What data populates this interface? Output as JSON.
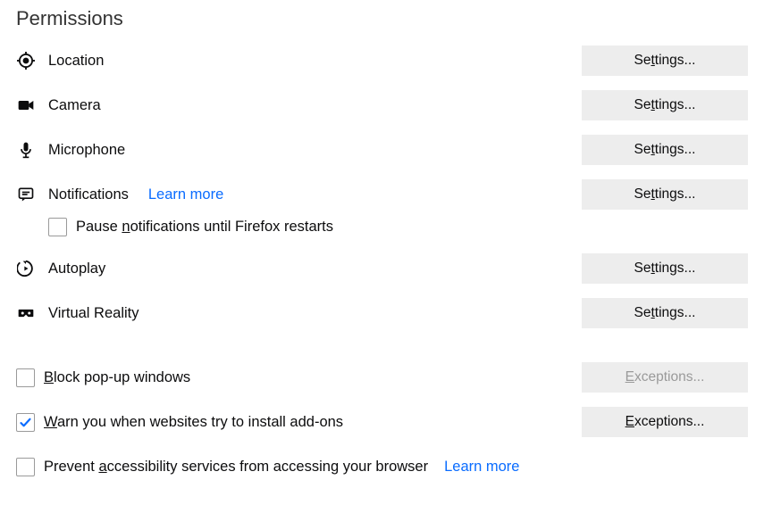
{
  "title": "Permissions",
  "items": {
    "location": {
      "label": "Location",
      "button": "Se<u>t</u>tings..."
    },
    "camera": {
      "label": "Camera",
      "button": "Se<u>t</u>tings..."
    },
    "microphone": {
      "label": "Microphone",
      "button": "Se<u>t</u>tings..."
    },
    "notifications": {
      "label": "Notifications",
      "learn_more": "Learn more",
      "button": "Se<u>t</u>tings...",
      "pause_label": "Pause <u>n</u>otifications until Firefox restarts",
      "pause_checked": false
    },
    "autoplay": {
      "label": "Autoplay",
      "button": "Se<u>t</u>tings..."
    },
    "vr": {
      "label": "Virtual Reality",
      "button": "Se<u>t</u>tings..."
    }
  },
  "checkboxes": {
    "block_popups": {
      "label": "<u>B</u>lock pop-up windows",
      "checked": false,
      "button": "<u>E</u>xceptions...",
      "button_enabled": false
    },
    "warn_addons": {
      "label": "<u>W</u>arn you when websites try to install add-ons",
      "checked": true,
      "button": "<u>E</u>xceptions...",
      "button_enabled": true
    },
    "prevent_accessibility": {
      "label": "Prevent <u>a</u>ccessibility services from accessing your browser",
      "checked": false,
      "learn_more": "Learn more"
    }
  }
}
